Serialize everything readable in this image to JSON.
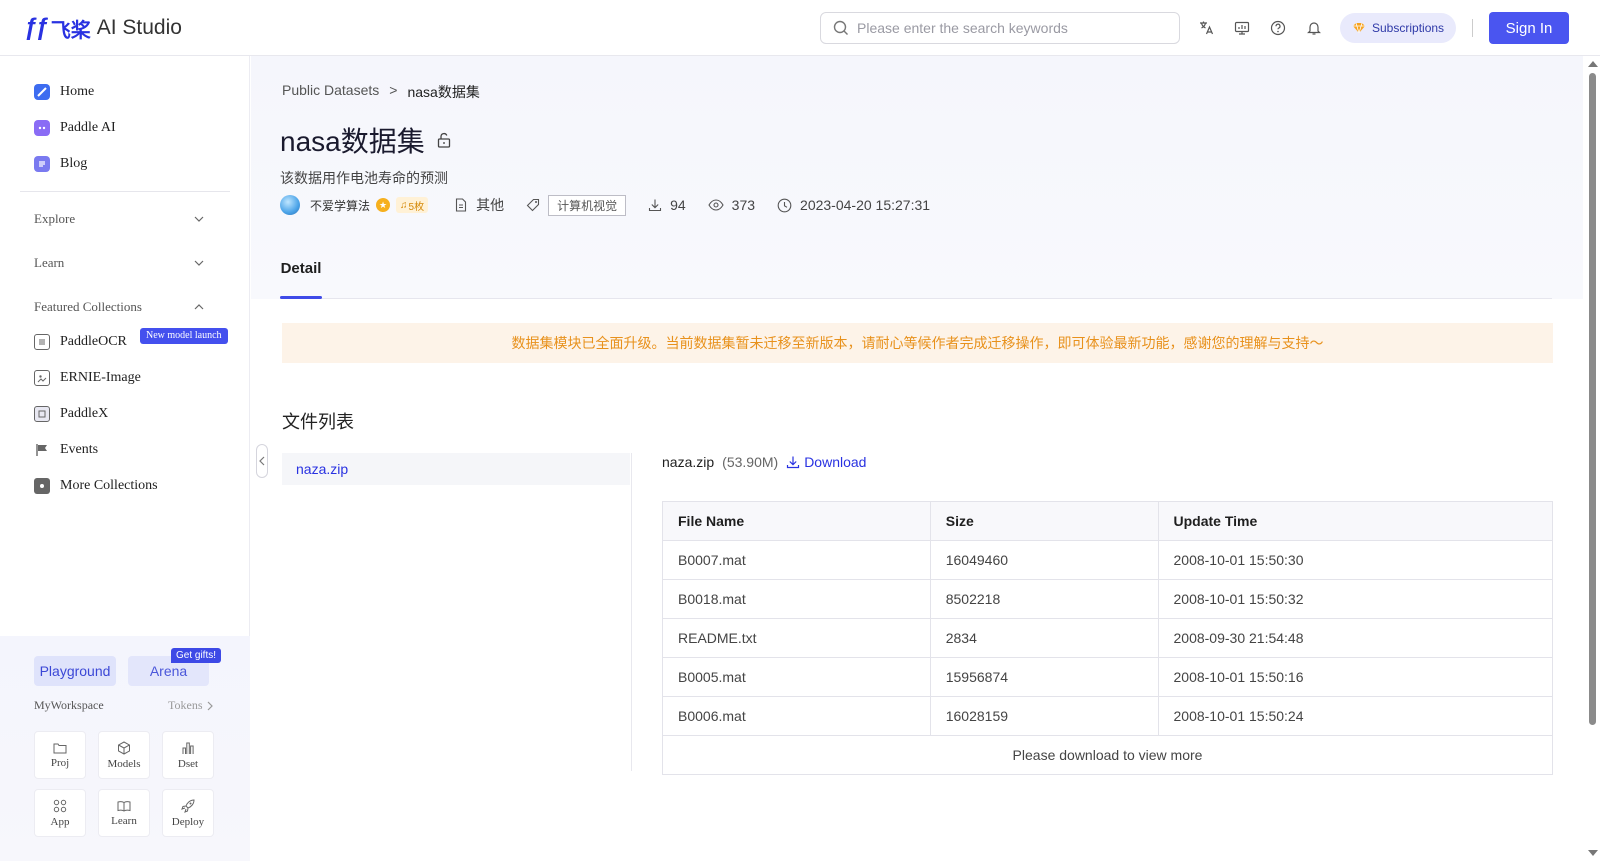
{
  "header": {
    "logo_cn": "飞桨",
    "logo_text": "AI Studio",
    "search_placeholder": "Please enter the search keywords",
    "subscriptions_label": "Subscriptions",
    "signin_label": "Sign In"
  },
  "sidebar": {
    "main_items": [
      {
        "label": "Home",
        "icon": "home-icon",
        "color": "#3d6cf0"
      },
      {
        "label": "Paddle AI",
        "icon": "paddle-ai-icon",
        "color": "#8a6cf5"
      },
      {
        "label": "Blog",
        "icon": "blog-icon",
        "color": "#7a7af0"
      }
    ],
    "groups": [
      {
        "label": "Explore",
        "state": "collapsed"
      },
      {
        "label": "Learn",
        "state": "collapsed"
      },
      {
        "label": "Featured Collections",
        "state": "expanded"
      }
    ],
    "collections": [
      {
        "label": "PaddleOCR",
        "icon": "paddleocr-icon",
        "badge": "New model launch"
      },
      {
        "label": "ERNIE-Image",
        "icon": "image-icon"
      },
      {
        "label": "PaddleX",
        "icon": "paddlex-icon"
      },
      {
        "label": "Events",
        "icon": "flag-icon"
      },
      {
        "label": "More Collections",
        "icon": "collections-icon"
      }
    ],
    "workspace": {
      "playground_label": "Playground",
      "arena_label": "Arena",
      "gift_badge": "Get gifts!",
      "title": "MyWorkspace",
      "tokens_label": "Tokens",
      "tiles": [
        {
          "label": "Proj",
          "icon": "folder-icon"
        },
        {
          "label": "Models",
          "icon": "cube-icon"
        },
        {
          "label": "Dset",
          "icon": "bar-chart-icon"
        },
        {
          "label": "App",
          "icon": "apps-icon"
        },
        {
          "label": "Learn",
          "icon": "book-icon"
        },
        {
          "label": "Deploy",
          "icon": "rocket-icon"
        }
      ]
    }
  },
  "breadcrumb": {
    "parent": "Public Datasets",
    "separator": ">",
    "current": "nasa数据集"
  },
  "dataset": {
    "title": "nasa数据集",
    "description": "该数据用作电池寿命的预测",
    "author": "不爱学算法",
    "level": "5枚",
    "license": "其他",
    "tag": "计算机视觉",
    "downloads": "94",
    "views": "373",
    "updated": "2023-04-20 15:27:31"
  },
  "tabs": {
    "detail_label": "Detail"
  },
  "notice": "数据集模块已全面升级。当前数据集暂未迁移至新版本，请耐心等候作者完成迁移操作，即可体验最新功能，感谢您的理解与支持～",
  "files": {
    "heading": "文件列表",
    "list": [
      "naza.zip"
    ],
    "selected": {
      "name": "naza.zip",
      "size": "(53.90M)",
      "download_label": "Download"
    },
    "columns": [
      "File Name",
      "Size",
      "Update Time"
    ],
    "rows": [
      [
        "B0007.mat",
        "16049460",
        "2008-10-01 15:50:30"
      ],
      [
        "B0018.mat",
        "8502218",
        "2008-10-01 15:50:32"
      ],
      [
        "README.txt",
        "2834",
        "2008-09-30 21:54:48"
      ],
      [
        "B0005.mat",
        "15956874",
        "2008-10-01 15:50:16"
      ],
      [
        "B0006.mat",
        "16028159",
        "2008-10-01 15:50:24"
      ]
    ],
    "more_label": "Please download to view more"
  },
  "colors": {
    "accent": "#2932e1",
    "primary_button": "#4a55f0",
    "notice_text": "#e8911c",
    "notice_bg": "#fdf3e8"
  }
}
